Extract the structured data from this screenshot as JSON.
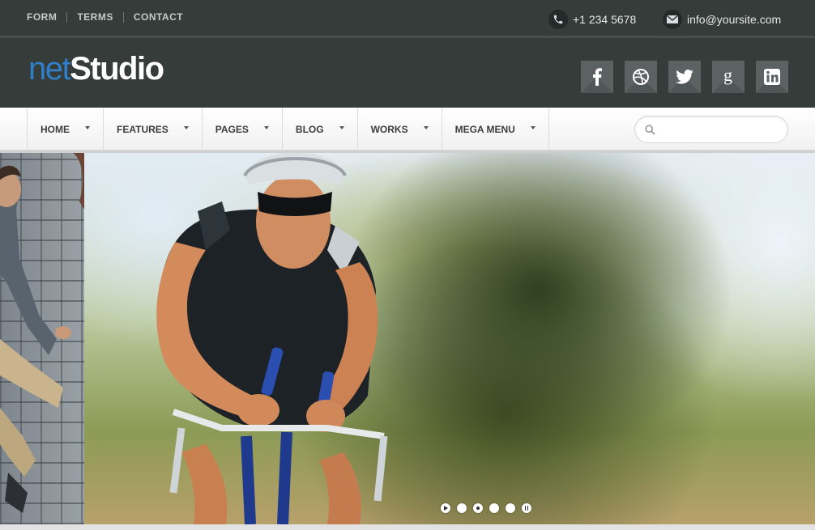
{
  "topbar": {
    "links": [
      "FORM",
      "TERMS",
      "CONTACT"
    ],
    "phone": "+1 234 5678",
    "email": "info@yoursite.com"
  },
  "logo": {
    "part1": "net",
    "part2": "Studio"
  },
  "socials": [
    "facebook-icon",
    "dribbble-icon",
    "twitter-icon",
    "google-plus-icon",
    "linkedin-icon"
  ],
  "nav": {
    "items": [
      "HOME",
      "FEATURES",
      "PAGES",
      "BLOG",
      "WORKS",
      "MEGA MENU"
    ],
    "search_placeholder": ""
  },
  "slider": {
    "controls": [
      "play",
      "slide-1",
      "slide-2",
      "slide-3",
      "slide-4",
      "pause"
    ],
    "active_index": 1
  },
  "colors": {
    "header_bg": "#353c3a",
    "brand_blue": "#2f7fc9",
    "social_bg": "#5b6261"
  }
}
